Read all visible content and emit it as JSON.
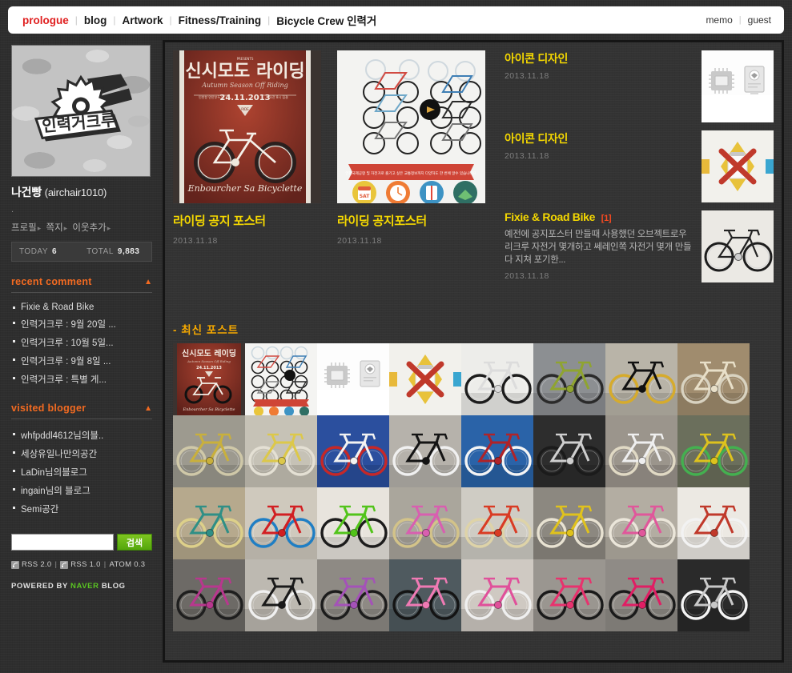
{
  "header": {
    "nav": [
      {
        "label": "prologue",
        "active": true
      },
      {
        "label": "blog",
        "active": false
      },
      {
        "label": "Artwork",
        "active": false
      },
      {
        "label": "Fitness/Training",
        "active": false
      },
      {
        "label": "Bicycle Crew 인력거",
        "active": false
      }
    ],
    "right": [
      {
        "label": "memo"
      },
      {
        "label": "guest"
      }
    ],
    "separator": "|",
    "accent_color": "#e02020"
  },
  "sidebar": {
    "avatar": {
      "logo_text": "인력거크루",
      "alt": "camouflage-logo"
    },
    "profile": {
      "name": "나건빵",
      "handle": "(airchair1010)",
      "description": ".",
      "links": [
        {
          "label": "프로필"
        },
        {
          "label": "쪽지"
        },
        {
          "label": "이웃추가"
        }
      ]
    },
    "stats": {
      "today_label": "TODAY",
      "today_value": "6",
      "total_label": "TOTAL",
      "total_value": "9,883"
    },
    "sections": [
      {
        "title": "recent comment",
        "collapse_icon": "chevron-up-icon",
        "items": [
          "Fixie & Road Bike",
          "인력거크루 : 9월 20일 ...",
          "인력거크루 : 10월 5일...",
          "인력거크루 : 9월 8일 ...",
          "인력거크루 : 특별 게..."
        ]
      },
      {
        "title": "visited blogger",
        "collapse_icon": "chevron-up-icon",
        "items": [
          "whfpddl4612님의블..",
          "세상유일나만의공간",
          "LaDin님의블로그",
          "ingain님의 블로그",
          "Semi공간"
        ]
      }
    ],
    "search": {
      "value": "",
      "placeholder": "",
      "button_label": "검색"
    },
    "rss": {
      "items": [
        "RSS 2.0",
        "RSS 1.0",
        "ATOM 0.3"
      ],
      "separator": "|"
    },
    "powered": {
      "prefix": "POWERED BY",
      "brand": "NAVER",
      "suffix": "BLOG"
    },
    "accent_color": "#f26a21"
  },
  "main": {
    "featured": [
      {
        "title": "라이딩 공지 포스터",
        "date": "2013.11.18",
        "thumb": "riding-poster-red"
      },
      {
        "title": "라이딩 공지포스터",
        "date": "2013.11.18",
        "thumb": "bike-grid-poster"
      }
    ],
    "posts": [
      {
        "title": "아이콘 디자인",
        "comment_count": "",
        "excerpt": "",
        "date": "2013.11.18",
        "thumb": "icon-chip-book"
      },
      {
        "title": "아이콘 디자인",
        "comment_count": "",
        "excerpt": "",
        "date": "2013.11.18",
        "thumb": "icon-x-diamond"
      },
      {
        "title": "Fixie & Road Bike",
        "comment_count": "[1]",
        "excerpt": "예전에 공지포스터 만들때 사용했던 오브젝트로우리크루 자전거 몇개하고 쎄레인쪽 자전거 몇개 만들다 지쳐 포기한...",
        "date": "2013.11.18",
        "thumb": "white-road-bike"
      }
    ],
    "recent_section": {
      "title": "- 최신 포스트",
      "accent_color": "#f5a800"
    },
    "grid": [
      {
        "name": "riding-poster-red",
        "kind": "poster-red"
      },
      {
        "name": "bike-grid-poster",
        "kind": "poster-grid"
      },
      {
        "name": "icon-chip-book",
        "kind": "icon-chip"
      },
      {
        "name": "icon-x-diamond",
        "kind": "icon-x"
      },
      {
        "name": "white-road-bike",
        "kind": "bike",
        "frame": "#dcdcdc",
        "bg": "#ededea",
        "wheel": "#1c1c1c"
      },
      {
        "name": "crew-bridge-photo",
        "kind": "bike",
        "frame": "#8fa430",
        "bg": "#8c8f92",
        "wheel": "#2a2a2a"
      },
      {
        "name": "black-gold-fixie",
        "kind": "bike",
        "frame": "#111111",
        "bg": "#b9b4a8",
        "wheel": "#d6ab2c"
      },
      {
        "name": "cream-red-track",
        "kind": "bike",
        "frame": "#e8dfc8",
        "bg": "#a08c6e",
        "wheel": "#d8d2c0"
      },
      {
        "name": "yellow-red-road",
        "kind": "bike",
        "frame": "#c9b03c",
        "bg": "#9d9a8f",
        "wheel": "#cfc8a8"
      },
      {
        "name": "yellow-stripe-track",
        "kind": "bike",
        "frame": "#dcc84a",
        "bg": "#c6c2b6",
        "wheel": "#e4e0d4"
      },
      {
        "name": "white-red-blue-bg",
        "kind": "bike",
        "frame": "#f2f2f2",
        "bg": "#2b4f9e",
        "wheel": "#c62828"
      },
      {
        "name": "black-white-fixie",
        "kind": "bike",
        "frame": "#141414",
        "bg": "#b6b2ab",
        "wheel": "#f0f0f0"
      },
      {
        "name": "red-white-blue-bg",
        "kind": "bike",
        "frame": "#b02328",
        "bg": "#2a63a8",
        "wheel": "#f4f4f4"
      },
      {
        "name": "silver-dark-wall",
        "kind": "bike",
        "frame": "#cfcfcf",
        "bg": "#2d2d2d",
        "wheel": "#1b1b1b"
      },
      {
        "name": "white-fence-bike",
        "kind": "bike",
        "frame": "#efefef",
        "bg": "#9b958c",
        "wheel": "#e0d9c4"
      },
      {
        "name": "yellow-green-pink",
        "kind": "bike",
        "frame": "#ddc21e",
        "bg": "#6b6f5c",
        "wheel": "#44b050"
      },
      {
        "name": "teal-cream-road",
        "kind": "bike",
        "frame": "#2f8f86",
        "bg": "#b6a98d",
        "wheel": "#ddd08a"
      },
      {
        "name": "red-blue-track",
        "kind": "bike",
        "frame": "#d21f22",
        "bg": "#cfc9bd",
        "wheel": "#1f7ec4"
      },
      {
        "name": "green-white-bg",
        "kind": "bike",
        "frame": "#52c41a",
        "bg": "#e8e4dd",
        "wheel": "#1c1c1c"
      },
      {
        "name": "pink-brick-wall",
        "kind": "bike",
        "frame": "#d85fb0",
        "bg": "#aaa69c",
        "wheel": "#d3c389"
      },
      {
        "name": "red-cream-wheel",
        "kind": "bike",
        "frame": "#d93b24",
        "bg": "#cfccc4",
        "wheel": "#ded3a8"
      },
      {
        "name": "yellow-street",
        "kind": "bike",
        "frame": "#e0c21c",
        "bg": "#8c8880",
        "wheel": "#e8e2d2"
      },
      {
        "name": "pink-bollard",
        "kind": "bike",
        "frame": "#e0579b",
        "bg": "#b3ada2",
        "wheel": "#ebe6da"
      },
      {
        "name": "red-dark-studio",
        "kind": "bike",
        "frame": "#c0392b",
        "bg": "#ece9e3",
        "wheel": "#f2f2f2"
      },
      {
        "name": "magenta-brick",
        "kind": "bike",
        "frame": "#b8378e",
        "bg": "#6d6a66",
        "wheel": "#1e1e1e"
      },
      {
        "name": "black-white-street",
        "kind": "bike",
        "frame": "#1a1a1a",
        "bg": "#bdb9b1",
        "wheel": "#f0f0f0"
      },
      {
        "name": "purple-fixie",
        "kind": "bike",
        "frame": "#a452b8",
        "bg": "#8e8a84",
        "wheel": "#1c1c1c"
      },
      {
        "name": "pink-black-night",
        "kind": "bike",
        "frame": "#f07ab4",
        "bg": "#4f5a5f",
        "wheel": "#141414"
      },
      {
        "name": "pink-white-rack",
        "kind": "bike",
        "frame": "#e0509a",
        "bg": "#cfc9c2",
        "wheel": "#efefef"
      },
      {
        "name": "pink-city-street",
        "kind": "bike",
        "frame": "#e8326e",
        "bg": "#9a9690",
        "wheel": "#191919"
      },
      {
        "name": "magenta-city",
        "kind": "bike",
        "frame": "#e01e64",
        "bg": "#8f8b86",
        "wheel": "#1a1a1a"
      },
      {
        "name": "silver-white-wheel",
        "kind": "bike",
        "frame": "#c8c8c8",
        "bg": "#2a2a2a",
        "wheel": "#f4f4f4"
      }
    ]
  }
}
